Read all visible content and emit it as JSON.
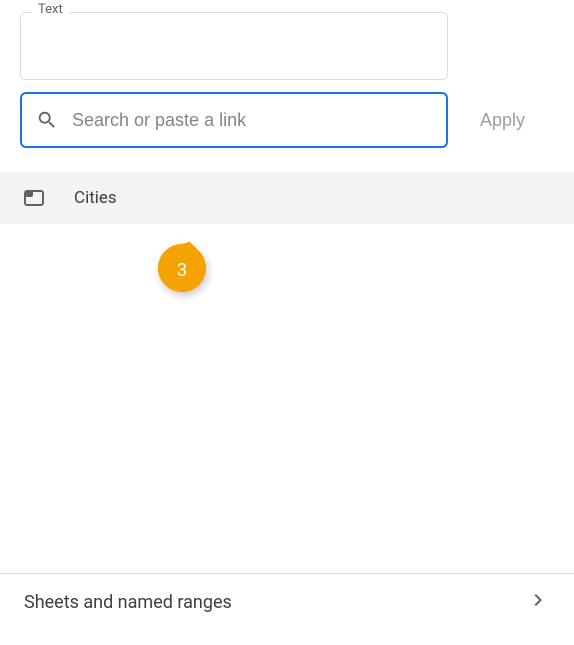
{
  "text_field": {
    "label": "Text",
    "value": ""
  },
  "search": {
    "placeholder": "Search or paste a link",
    "value": ""
  },
  "apply_label": "Apply",
  "suggestion": {
    "label": "Cities"
  },
  "badge": {
    "number": "3",
    "color": "#f5a302"
  },
  "sheets_row": {
    "label": "Sheets and named ranges"
  }
}
